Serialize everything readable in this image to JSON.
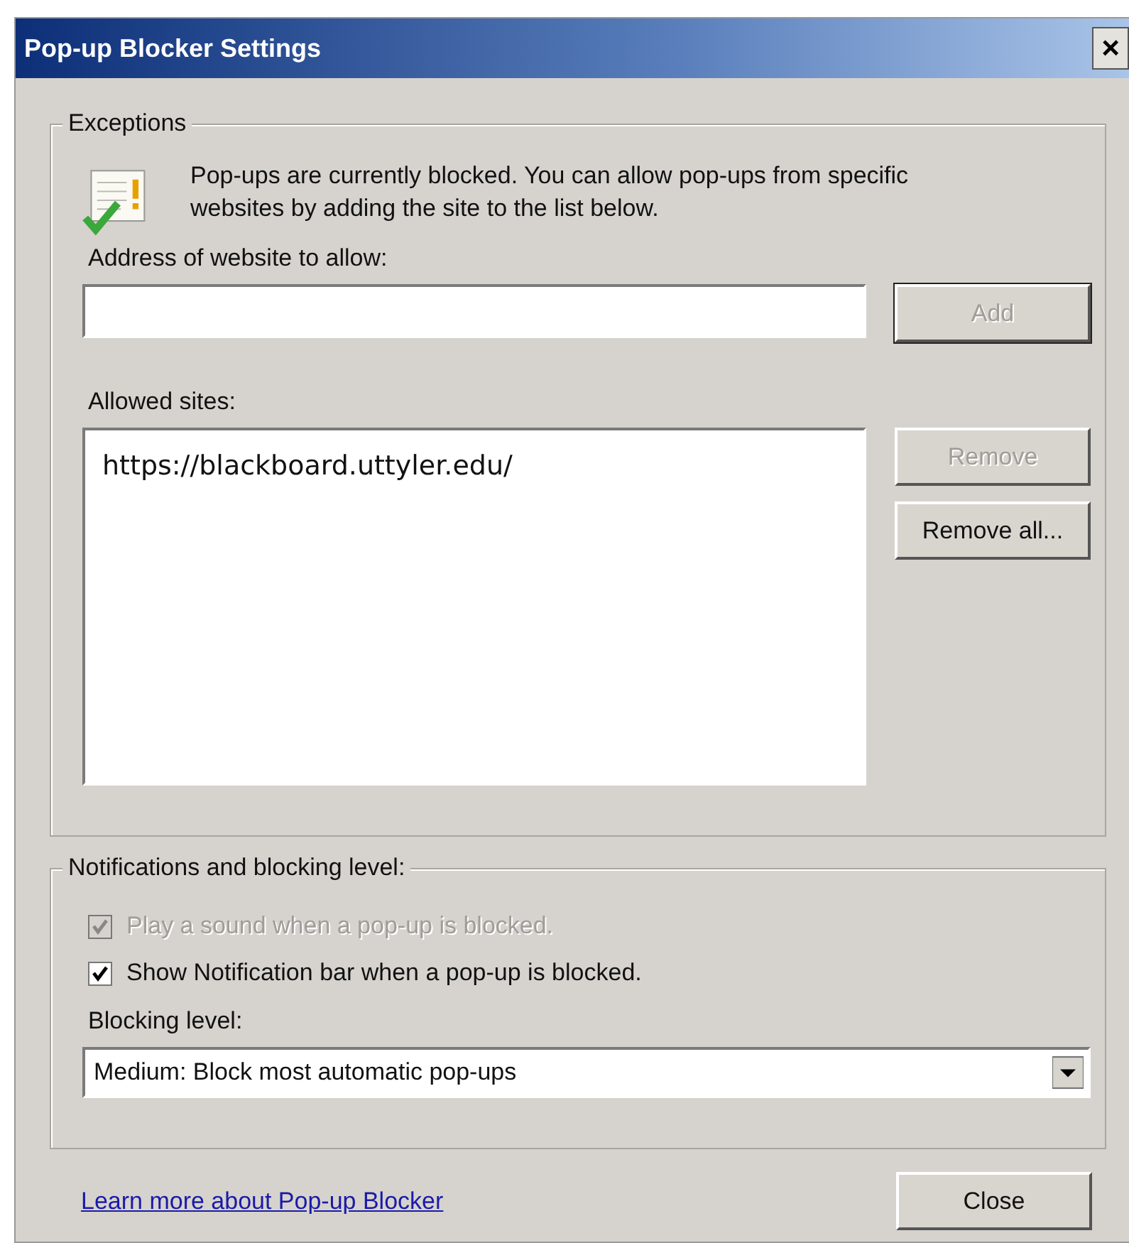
{
  "window": {
    "title": "Pop-up Blocker Settings",
    "close": "×"
  },
  "exceptions": {
    "legend": "Exceptions",
    "info": "Pop-ups are currently blocked.  You can allow pop-ups from specific websites by adding the site to the list below.",
    "address_label": "Address of website to allow:",
    "add_button": {
      "label": "Add",
      "disabled": true
    },
    "allowed_label": "Allowed sites:",
    "allowed_sites": [
      {
        "text": "https://blackboard.uttyler.edu/",
        "selected": false
      }
    ],
    "buttons": [
      {
        "label": "Remove",
        "disabled": true
      },
      {
        "label": "Remove all...",
        "disabled": false
      }
    ]
  },
  "notifications": {
    "legend": "Notifications and blocking level:",
    "options": [
      {
        "label": "Play a sound when a pop-up is blocked.",
        "checked": true,
        "disabled": true
      },
      {
        "label": "Show Notification bar when a pop-up is blocked.",
        "checked": true,
        "disabled": false
      }
    ],
    "blocking_label": "Blocking level:",
    "blocking_value": "Medium: Block most automatic pop-ups"
  },
  "footer": {
    "link": "Learn more about Pop-up Blocker",
    "close_button": "Close"
  }
}
